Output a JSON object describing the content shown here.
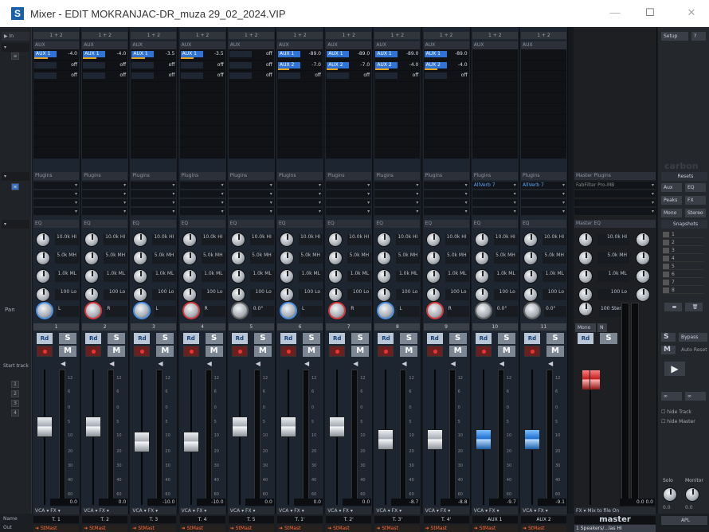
{
  "window": {
    "title": "Mixer - EDIT MOKRANJAC-DR_muza 29_02_2024.VIP",
    "app_icon": "S",
    "min": "—",
    "max": "☐",
    "close": "✕"
  },
  "left": {
    "in": "▶ In",
    "start_track": "Start track",
    "name": "Name",
    "out": "Out",
    "pan": "Pan",
    "tracks": [
      "1",
      "2",
      "3",
      "4"
    ]
  },
  "section_labels": {
    "aux": "AUX",
    "plugins": "Plugins",
    "eq": "EQ",
    "master_plugins": "Master Plugins",
    "master_eq": "Master EQ"
  },
  "channels": [
    {
      "num": "1",
      "input": "1 + 2",
      "aux": [
        {
          "name": "AUX 1",
          "val": "-4.0",
          "active": true,
          "bar": 0.6
        },
        {
          "name": "",
          "val": "off"
        },
        {
          "name": "",
          "val": "off"
        }
      ],
      "plug": [
        "",
        ""
      ],
      "eq": [
        "10.0k HI",
        "5.0k MH",
        "1.0k ML",
        "100 Lo"
      ],
      "pan": "L",
      "pan_col": "blue",
      "fader": 0.45,
      "fader_col": "grey",
      "level": "0.0",
      "name": "T. 1",
      "out": "StMast",
      "rd": "Rd",
      "s": "S",
      "m": "M",
      "vca": "VCA",
      "fx": "FX"
    },
    {
      "num": "2",
      "input": "1 + 2",
      "aux": [
        {
          "name": "AUX 1",
          "val": "-4.0",
          "active": true,
          "bar": 0.6
        },
        {
          "name": "",
          "val": "off"
        },
        {
          "name": "",
          "val": "off"
        }
      ],
      "plug": [
        "",
        ""
      ],
      "eq": [
        "10.0k HI",
        "5.0k MH",
        "1.0k ML",
        "100 Lo"
      ],
      "pan": "R",
      "pan_col": "red",
      "fader": 0.45,
      "fader_col": "grey",
      "level": "0.0",
      "name": "T. 2",
      "out": "StMast",
      "rd": "Rd",
      "s": "S",
      "m": "M",
      "vca": "VCA",
      "fx": "FX"
    },
    {
      "num": "3",
      "input": "1 + 2",
      "aux": [
        {
          "name": "AUX 1",
          "val": "-3.5",
          "active": true,
          "bar": 0.6
        },
        {
          "name": "",
          "val": "off"
        },
        {
          "name": "",
          "val": "off"
        }
      ],
      "plug": [
        "",
        ""
      ],
      "eq": [
        "10.0k HI",
        "5.0k MH",
        "1.0k ML",
        "100 Lo"
      ],
      "pan": "L",
      "pan_col": "blue",
      "fader": 0.6,
      "fader_col": "grey",
      "level": "-10.0",
      "name": "T. 3",
      "out": "StMast",
      "rd": "Rd",
      "s": "S",
      "m": "M",
      "vca": "VCA",
      "fx": "FX"
    },
    {
      "num": "4",
      "input": "1 + 2",
      "aux": [
        {
          "name": "AUX 1",
          "val": "-3.5",
          "active": true,
          "bar": 0.6
        },
        {
          "name": "",
          "val": "off"
        },
        {
          "name": "",
          "val": "off"
        }
      ],
      "plug": [
        "",
        ""
      ],
      "eq": [
        "10.0k HI",
        "5.0k MH",
        "1.0k ML",
        "100 Lo"
      ],
      "pan": "R",
      "pan_col": "red",
      "fader": 0.6,
      "fader_col": "grey",
      "level": "-10.0",
      "name": "T. 4",
      "out": "StMast",
      "rd": "Rd",
      "s": "S",
      "m": "M",
      "vca": "VCA",
      "fx": "FX"
    },
    {
      "num": "5",
      "input": "1 + 2",
      "aux": [
        {
          "name": "",
          "val": "off"
        },
        {
          "name": "",
          "val": "off"
        },
        {
          "name": "",
          "val": "off"
        }
      ],
      "plug": [
        "",
        ""
      ],
      "eq": [
        "10.0k HI",
        "5.0k MH",
        "1.0k ML",
        "100 Lo"
      ],
      "pan": "0.0°",
      "pan_col": "grey",
      "fader": 0.45,
      "fader_col": "grey",
      "level": "0.0",
      "name": "T. 5",
      "out": "StMast",
      "rd": "Rd",
      "s": "S",
      "m": "M",
      "vca": "VCA",
      "fx": "FX"
    },
    {
      "num": "6",
      "input": "1 + 2",
      "aux": [
        {
          "name": "AUX 1",
          "val": "-89.0",
          "active": true,
          "bar": 0
        },
        {
          "name": "AUX 2",
          "val": "-7.0",
          "active": true,
          "bar": 0.5
        },
        {
          "name": "",
          "val": "off"
        }
      ],
      "plug": [
        "",
        ""
      ],
      "eq": [
        "10.0k HI",
        "5.0k MH",
        "1.0k ML",
        "100 Lo"
      ],
      "pan": "L",
      "pan_col": "blue",
      "fader": 0.45,
      "fader_col": "grey",
      "level": "0.0",
      "name": "T. 1'",
      "out": "StMast",
      "rd": "Rd",
      "s": "S",
      "m": "M",
      "vca": "VCA",
      "fx": "FX"
    },
    {
      "num": "7",
      "input": "1 + 2",
      "aux": [
        {
          "name": "AUX 1",
          "val": "-89.0",
          "active": true,
          "bar": 0
        },
        {
          "name": "AUX 2",
          "val": "-7.0",
          "active": true,
          "bar": 0.5
        },
        {
          "name": "",
          "val": "off"
        }
      ],
      "plug": [
        "",
        ""
      ],
      "eq": [
        "10.0k HI",
        "5.0k MH",
        "1.0k ML",
        "100 Lo"
      ],
      "pan": "R",
      "pan_col": "red",
      "fader": 0.45,
      "fader_col": "grey",
      "level": "0.0",
      "name": "T. 2'",
      "out": "StMast",
      "rd": "Rd",
      "s": "S",
      "m": "M",
      "vca": "VCA",
      "fx": "FX"
    },
    {
      "num": "8",
      "input": "1 + 2",
      "aux": [
        {
          "name": "AUX 1",
          "val": "-89.0",
          "active": true,
          "bar": 0
        },
        {
          "name": "AUX 2",
          "val": "-4.0",
          "active": true,
          "bar": 0.6
        },
        {
          "name": "",
          "val": "off"
        }
      ],
      "plug": [
        "",
        ""
      ],
      "eq": [
        "10.0k HI",
        "5.0k MH",
        "1.0k ML",
        "100 Lo"
      ],
      "pan": "L",
      "pan_col": "blue",
      "fader": 0.58,
      "fader_col": "grey",
      "level": "-8.7",
      "name": "T. 3'",
      "out": "StMast",
      "rd": "Rd",
      "s": "S",
      "m": "M",
      "vca": "VCA",
      "fx": "FX"
    },
    {
      "num": "9",
      "input": "1 + 2",
      "aux": [
        {
          "name": "AUX 1",
          "val": "-89.0",
          "active": true,
          "bar": 0
        },
        {
          "name": "AUX 2",
          "val": "-4.0",
          "active": true,
          "bar": 0.6
        },
        {
          "name": "",
          "val": "off"
        }
      ],
      "plug": [
        "",
        ""
      ],
      "eq": [
        "10.0k HI",
        "5.0k MH",
        "1.0k ML",
        "100 Lo"
      ],
      "pan": "R",
      "pan_col": "red",
      "fader": 0.58,
      "fader_col": "grey",
      "level": "-8.8",
      "name": "T. 4'",
      "out": "StMast",
      "rd": "Rd",
      "s": "S",
      "m": "M",
      "vca": "VCA",
      "fx": "FX"
    },
    {
      "num": "10",
      "input": "1 + 2",
      "aux": true,
      "plug": [
        "AllVerb 7",
        ""
      ],
      "eq": [
        "10.0k HI",
        "5.0k MH",
        "1.0k ML",
        "100 Lo"
      ],
      "pan": "0.0°",
      "pan_col": "grey",
      "fader": 0.58,
      "fader_col": "blue",
      "level": "-9.7",
      "name": "AUX 1",
      "out": "StMast",
      "rd": "Rd",
      "s": "S",
      "m": "M",
      "vca": "VCA",
      "fx": "FX"
    },
    {
      "num": "11",
      "input": "1 + 2",
      "aux": true,
      "plug": [
        "AllVerb 7",
        ""
      ],
      "eq": [
        "10.0k HI",
        "5.0k MH",
        "1.0k ML",
        "100 Lo"
      ],
      "pan": "0.0°",
      "pan_col": "grey",
      "fader": 0.58,
      "fader_col": "blue",
      "level": "-9.1",
      "name": "AUX 2",
      "out": "StMast",
      "rd": "Rd",
      "s": "S",
      "m": "M",
      "vca": "VCA",
      "fx": "FX"
    }
  ],
  "master": {
    "plugin": "FabFilter Pro-MB",
    "mono": "Mono",
    "n": "N",
    "rd": "Rd",
    "s": "S",
    "name": "master",
    "fx": "FX",
    "mix": "Mix to file",
    "on": "On",
    "out": "1 Speakers/...las HI",
    "levels": "0.0  0.0",
    "width": "100 Ster.",
    "eq": [
      "10.0k HI",
      "5.0k MH",
      "1.0k ML",
      "100 Lo"
    ]
  },
  "right": {
    "setup": "Setup",
    "help": "?",
    "brand": "carbon",
    "resets": "Resets",
    "aux": "Aux",
    "eq": "EQ",
    "peaks": "Peaks",
    "fx": "FX",
    "mono": "Mono",
    "stereo": "Stereo",
    "snapshots": "Snapshots",
    "snap_items": [
      "1",
      "2",
      "3",
      "4",
      "5",
      "6",
      "7",
      "8"
    ],
    "s": "S",
    "bypass": "Bypass",
    "m": "M",
    "auto": "Auto Reset",
    "hide_track": "hide Track",
    "hide_master": "hide Master",
    "solo": "Solo",
    "monitor": "Monitor",
    "val1": "0.0",
    "val2": "0.0",
    "apl": "APL"
  }
}
